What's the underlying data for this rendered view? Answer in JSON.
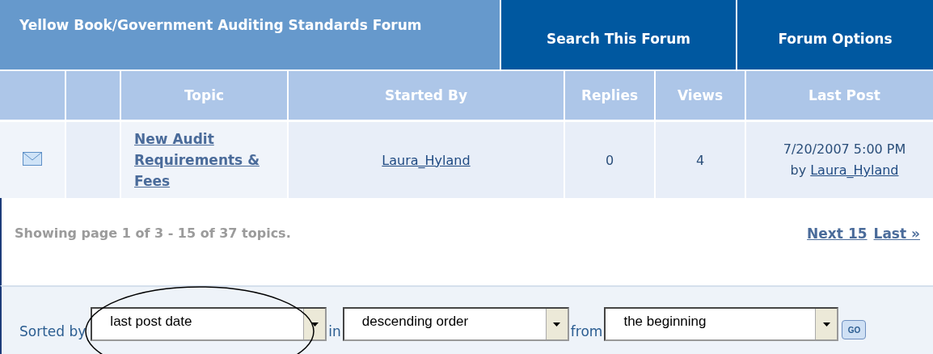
{
  "forum_header": {
    "title": "Yellow Book/Government Auditing Standards Forum",
    "buttons": [
      "Search This Forum",
      "Forum Options"
    ]
  },
  "table": {
    "columns": [
      "",
      "",
      "Topic",
      "Started By",
      "Replies",
      "Views",
      "Last Post"
    ],
    "rows": [
      {
        "topic": "New Audit Requirements & Fees",
        "started_by": "Laura_Hyland",
        "replies": "0",
        "views": "4",
        "last_post_date": "7/20/2007 5:00 PM",
        "last_post_by_label": "by",
        "last_post_by": "Laura_Hyland"
      }
    ]
  },
  "pagination": {
    "summary": "Showing page 1 of 3 - 15 of 37 topics.",
    "links": [
      "Next 15",
      "Last »"
    ]
  },
  "sort_bar": {
    "parts": [
      {
        "label": "Sorted by",
        "value": "last post date"
      },
      {
        "label": "in",
        "value": "descending order"
      },
      {
        "label": "from",
        "value": "the beginning"
      }
    ],
    "go_button": "GO"
  }
}
